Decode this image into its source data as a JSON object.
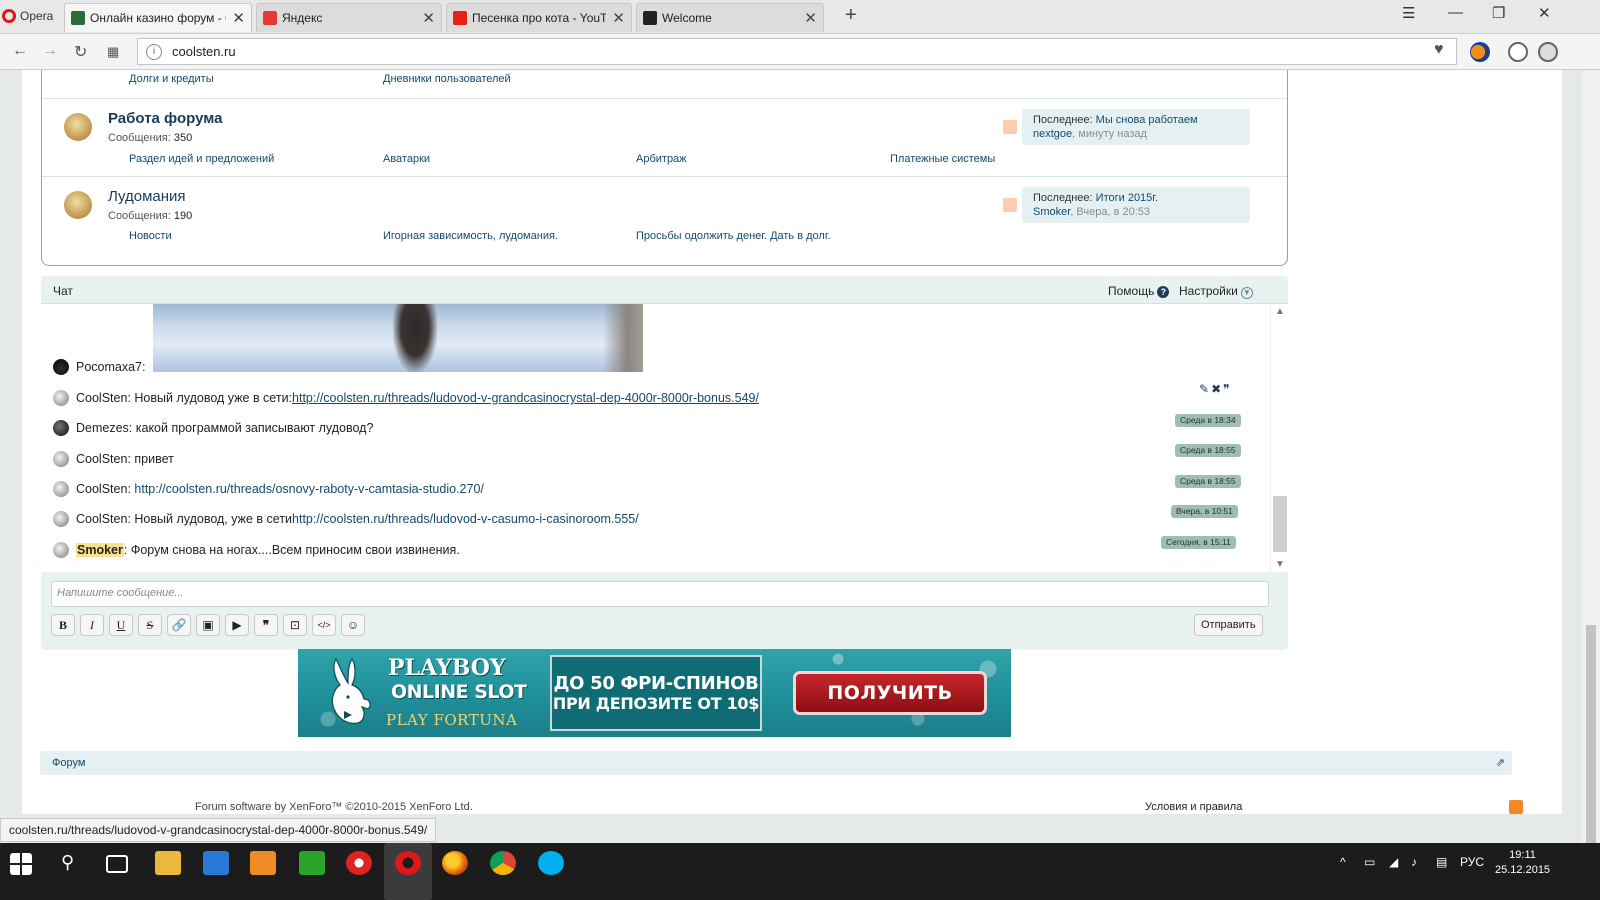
{
  "browser": {
    "menu_label": "Opera",
    "tabs": [
      {
        "title": "Онлайн казино форум - С",
        "favicon_color": "#2d6b3a",
        "active": true
      },
      {
        "title": "Яндекс",
        "favicon_color": "#e53935"
      },
      {
        "title": "Песенка про кота - YouTu",
        "favicon_color": "#e62117"
      },
      {
        "title": "Welcome",
        "favicon_color": "#222222"
      }
    ],
    "address": "coolsten.ru"
  },
  "forum": {
    "top_subforums": [
      "Долги и кредиты",
      "Дневники пользователей"
    ],
    "nodes": [
      {
        "title": "Работа форума",
        "count_label": "Сообщения:",
        "count": "350",
        "subforums": [
          "Раздел идей и предложений",
          "Аватарки",
          "Арбитраж",
          "Платежные системы"
        ],
        "last_label": "Последнее:",
        "last_title": "Мы снова работаем",
        "last_user": "nextgoe",
        "last_time": "минуту назад"
      },
      {
        "title": "Лудомания",
        "count_label": "Сообщения:",
        "count": "190",
        "subforums": [
          "Новости",
          "Игорная зависимость, лудомания.",
          "Просьбы одолжить денег. Дать в долг."
        ],
        "last_label": "Последнее:",
        "last_title": "Итоги 2015г.",
        "last_user": "Smoker",
        "last_time": "Вчера, в 20:53"
      }
    ]
  },
  "chat": {
    "title": "Чат",
    "help_label": "Помощь",
    "settings_label": "Настройки",
    "messages": [
      {
        "user": "Pocomaxa7",
        "text": "",
        "link": "",
        "time": ""
      },
      {
        "user": "CoolSten",
        "text": "Новый лудовод уже в сети: ",
        "link": "http://coolsten.ru/threads/ludovod-v-grandcasinocrystal-dep-4000r-8000r-bonus.549/",
        "time": "Среда в 18:34"
      },
      {
        "user": "Demezes",
        "text": "какой программой записывают лудовод?",
        "link": "",
        "time": "Среда в 18:55"
      },
      {
        "user": "CoolSten",
        "text": "привет",
        "link": "",
        "time": "Среда в 18:55"
      },
      {
        "user": "CoolSten",
        "text": "",
        "link": "http://coolsten.ru/threads/osnovy-raboty-v-camtasia-studio.270/",
        "time": "Вчера, в 10:51"
      },
      {
        "user": "CoolSten",
        "text": "Новый лудовод, уже в сети ",
        "link": "http://coolsten.ru/threads/ludovod-v-casumo-i-casinoroom.555/",
        "time": "Сегодня, в 15:11"
      },
      {
        "user": "Smoker",
        "text": "Форум снова на ногах....Всем приносим свои извинения.",
        "link": "",
        "time": ""
      }
    ],
    "input_placeholder": "Напишите сообщение...",
    "toolbar": [
      "B",
      "I",
      "U",
      "S",
      "🔗",
      "▣",
      "▶",
      "❞",
      "⊡",
      "</>",
      "☺"
    ],
    "send_label": "Отправить"
  },
  "banner": {
    "title": "PLAYBOY",
    "subtitle": "ONLINE SLOT",
    "brand": "PLAY FORTUNA",
    "offer_line1": "ДО 50 ФРИ-СПИНОВ",
    "offer_line2": "ПРИ ДЕПОЗИТЕ ОТ 10$",
    "button": "ПОЛУЧИТЬ"
  },
  "footer": {
    "breadcrumb": "Форум",
    "copyright": "Forum software by XenForo™ ©2010-2015 XenForo Ltd.",
    "terms": "Условия и правила"
  },
  "status_url": "coolsten.ru/threads/ludovod-v-grandcasinocrystal-dep-4000r-8000r-bonus.549/",
  "taskbar": {
    "lang": "РУС",
    "time": "19:11",
    "date": "25.12.2015"
  }
}
